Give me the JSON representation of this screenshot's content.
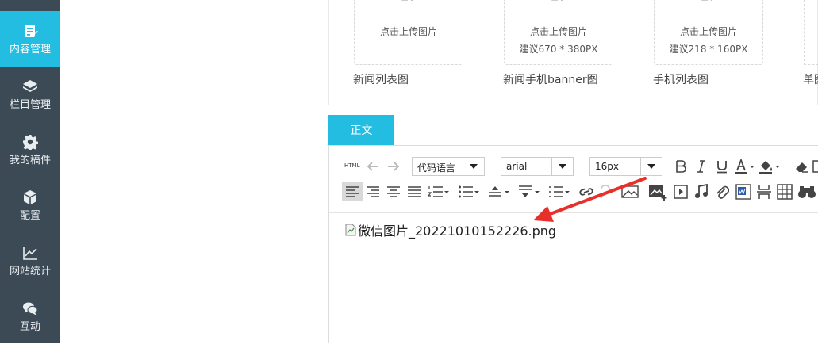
{
  "sidebar": {
    "items": [
      {
        "label": "内容管理",
        "icon": "edit-doc-icon",
        "active": true
      },
      {
        "label": "栏目管理",
        "icon": "layers-icon"
      },
      {
        "label": "我的稿件",
        "icon": "gear-icon"
      },
      {
        "label": "配置",
        "icon": "cube-icon"
      },
      {
        "label": "网站统计",
        "icon": "line-chart-icon"
      },
      {
        "label": "互动",
        "icon": "chat-bubbles-icon"
      }
    ]
  },
  "uploads": {
    "button_text": "点击上传图片",
    "items": [
      {
        "hint": "",
        "label": "新闻列表图"
      },
      {
        "hint": "建议670 * 380PX",
        "label": "新闻手机banner图"
      },
      {
        "hint": "建议218 * 160PX",
        "label": "手机列表图"
      },
      {
        "hint": "",
        "label": "单图"
      }
    ]
  },
  "editor": {
    "tab_label": "正文",
    "toolbar": {
      "html_label": "HTML",
      "code_lang_select": "代码语言",
      "font_family_select": "arial",
      "font_size_select": "16px"
    },
    "content": {
      "broken_image_alt": "微信图片_20221010152226.png"
    }
  },
  "colors": {
    "sidebar_bg": "#3c4a56",
    "accent": "#22bde0",
    "annotation_arrow": "#e8302a"
  }
}
